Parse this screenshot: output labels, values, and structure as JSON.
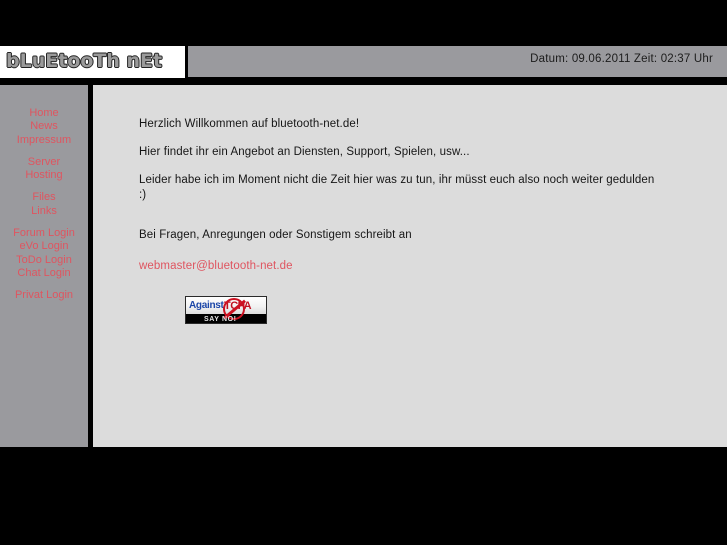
{
  "site": {
    "logo_text": "bLuEtooTh nEt",
    "accent_red": "#df5560",
    "header_bg": "#9a9a9e",
    "content_bg": "#dcdcdc",
    "page_bg": "#000000"
  },
  "header": {
    "datetime": "Datum: 09.06.2011  Zeit: 02:37 Uhr",
    "date_label": "Datum:",
    "date_value": "09.06.2011",
    "time_label": "Zeit:",
    "time_value": "02:37",
    "time_unit": "Uhr"
  },
  "sidebar": {
    "groups": [
      {
        "items": [
          {
            "label": "Home"
          },
          {
            "label": "News"
          },
          {
            "label": "Impressum"
          }
        ]
      },
      {
        "items": [
          {
            "label": "Server"
          },
          {
            "label": "Hosting"
          }
        ]
      },
      {
        "items": [
          {
            "label": "Files"
          },
          {
            "label": "Links"
          }
        ]
      },
      {
        "items": [
          {
            "label": "Forum Login"
          },
          {
            "label": "eVo Login"
          },
          {
            "label": "ToDo Login"
          },
          {
            "label": "Chat Login"
          }
        ]
      },
      {
        "items": [
          {
            "label": "Privat Login"
          }
        ]
      }
    ]
  },
  "main": {
    "paragraphs": [
      "Herzlich Willkommen auf bluetooth-net.de!",
      "Hier findet ihr ein Angebot an Diensten, Support, Spielen, usw...",
      "Leider habe ich im Moment nicht die Zeit hier was zu tun, ihr müsst euch also noch weiter gedulden :)",
      "Bei Fragen, Anregungen oder Sonstigem schreibt an"
    ],
    "welcome": "Herzlich Willkommen auf bluetooth-net.de!",
    "offer": "Hier findet ihr ein Angebot an Diensten, Support, Spielen, usw...",
    "notice": "Leider habe ich im Moment nicht die Zeit hier was zu tun, ihr müsst euch also noch weiter gedulden :)",
    "contact_intro": "Bei Fragen, Anregungen oder Sonstigem schreibt an",
    "email": "webmaster@bluetooth-net.de"
  },
  "banner": {
    "name": "against-tcpa-banner",
    "against_text": "Against",
    "target_text": "TCPA",
    "slogan": "SAY NO!",
    "link_color": "#1b46a8",
    "prohibit_color": "#cc1122"
  }
}
